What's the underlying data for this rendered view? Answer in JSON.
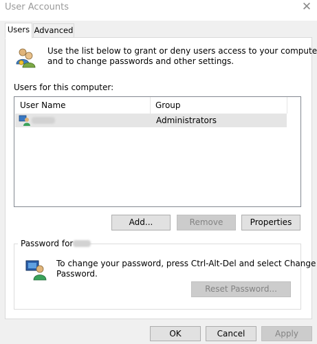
{
  "window": {
    "title": "User Accounts"
  },
  "tabs": [
    {
      "label": "Users"
    },
    {
      "label": "Advanced"
    }
  ],
  "intro": {
    "line1": "Use the list below to grant or deny users access to your computer,",
    "line2": "and to change passwords and other settings."
  },
  "users_section": {
    "label": "Users for this computer:",
    "columns": [
      "User Name",
      "Group"
    ],
    "rows": [
      {
        "group": "Administrators"
      }
    ]
  },
  "list_buttons": {
    "add": "Add...",
    "remove": "Remove",
    "properties": "Properties"
  },
  "password": {
    "legend": "Password for",
    "line1": "To change your password, press Ctrl-Alt-Del and select Change",
    "line2": "Password.",
    "reset_button": "Reset Password..."
  },
  "footer": {
    "ok": "OK",
    "cancel": "Cancel",
    "apply": "Apply"
  },
  "colors": {
    "dialog_bg": "#f0f0f0",
    "selected_row": "#e5e5e5",
    "disabled_button": "#cccccc"
  },
  "icons": {
    "users": "users-icon",
    "user": "user-icon",
    "password_user": "password-user-icon",
    "close": "close-icon"
  }
}
